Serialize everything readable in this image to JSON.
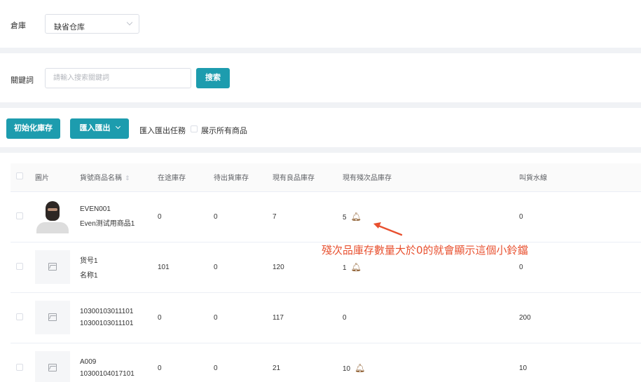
{
  "warehouse": {
    "label": "倉庫",
    "selected": "缺省仓库"
  },
  "keyword": {
    "label": "關鍵詞",
    "placeholder": "請輸入搜索關鍵詞",
    "search_button": "搜索"
  },
  "toolbar": {
    "init_button": "初始化庫存",
    "import_export_button": "匯入匯出",
    "tasks_link": "匯入匯出任務",
    "show_all_label": "展示所有商品"
  },
  "table": {
    "headers": [
      "圖片",
      "貨號商品名稱",
      "在途庫存",
      "待出貨庫存",
      "現有良品庫存",
      "現有殘次品庫存",
      "叫貨水線"
    ],
    "sort_icon": "⇕",
    "rows": [
      {
        "code": "EVEN001",
        "name": "Even测试用商品1",
        "in_transit": "0",
        "pending": "0",
        "good": "7",
        "defective": "5",
        "threshold": "0",
        "has_bell": true,
        "has_photo": true
      },
      {
        "code": "货号1",
        "name": "名称1",
        "in_transit": "101",
        "pending": "0",
        "good": "120",
        "defective": "1",
        "threshold": "0",
        "has_bell": true,
        "has_photo": false
      },
      {
        "code": "10300103011101",
        "name": "10300103011101",
        "in_transit": "0",
        "pending": "0",
        "good": "117",
        "defective": "0",
        "threshold": "200",
        "has_bell": false,
        "has_photo": false
      },
      {
        "code": "A009",
        "name": "10300104017101",
        "in_transit": "0",
        "pending": "0",
        "good": "21",
        "defective": "10",
        "threshold": "10",
        "has_bell": true,
        "has_photo": false
      }
    ]
  },
  "annotation": "殘次品庫存數量大於0的就會顯示這個小鈴鐺",
  "colors": {
    "accent": "#1d9cae",
    "annotation": "#e8502f",
    "bell": "#8b5a2b"
  },
  "icons": {
    "bell": "bell-icon",
    "placeholder": "image-placeholder-icon",
    "chevron": "chevron-down-icon"
  }
}
